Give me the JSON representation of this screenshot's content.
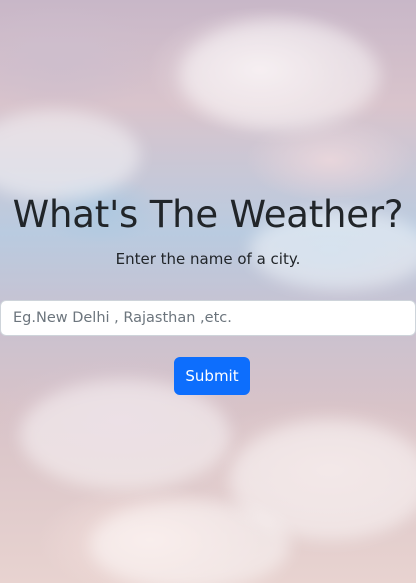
{
  "header": {
    "title": "What's The Weather?",
    "subtitle": "Enter the name of a city."
  },
  "search": {
    "value": "",
    "placeholder": "Eg.New Delhi , Rajasthan ,etc."
  },
  "actions": {
    "submit_label": "Submit"
  },
  "colors": {
    "primary_button": "#0d6efd",
    "text": "#212529"
  }
}
